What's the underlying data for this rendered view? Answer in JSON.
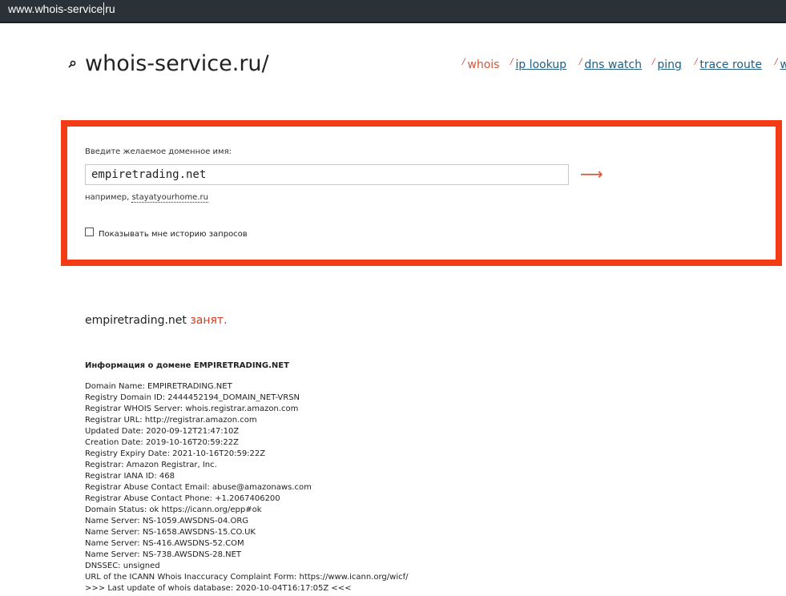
{
  "address_bar": {
    "url_before_caret": "www.whois-service",
    "url_after_caret": "ru"
  },
  "header": {
    "logo_text": "whois-service.ru/",
    "logo_icon": "magnifier-icon",
    "nav": [
      {
        "slash": "/",
        "label": "whois",
        "active": true
      },
      {
        "slash": "/",
        "label": "ip lookup",
        "active": false
      },
      {
        "slash": "/",
        "label": "dns watch",
        "active": false
      },
      {
        "slash": "/",
        "label": "ping",
        "active": false
      },
      {
        "slash": "/",
        "label": "trace route",
        "active": false
      },
      {
        "slash": "/",
        "label": "w",
        "active": false
      }
    ]
  },
  "search": {
    "label": "Введите желаемое доменное имя:",
    "input_value": "empiretrading.net",
    "submit_symbol": "⟶",
    "example_prefix": "например, ",
    "example_link": "stayatyourhome.ru",
    "history_label": "Показывать мне историю запросов",
    "border_color": "#f33b16"
  },
  "result": {
    "domain": "empiretrading.net",
    "status": "занят."
  },
  "info": {
    "heading": "Информация о домене EMPIRETRADING.NET",
    "lines": [
      "Domain Name: EMPIRETRADING.NET",
      "Registry Domain ID: 2444452194_DOMAIN_NET-VRSN",
      "Registrar WHOIS Server: whois.registrar.amazon.com",
      "Registrar URL: http://registrar.amazon.com",
      "Updated Date: 2020-09-12T21:47:10Z",
      "Creation Date: 2019-10-16T20:59:22Z",
      "Registry Expiry Date: 2021-10-16T20:59:22Z",
      "Registrar: Amazon Registrar, Inc.",
      "Registrar IANA ID: 468",
      "Registrar Abuse Contact Email: abuse@amazonaws.com",
      "Registrar Abuse Contact Phone: +1.2067406200",
      "Domain Status: ok https://icann.org/epp#ok",
      "Name Server: NS-1059.AWSDNS-04.ORG",
      "Name Server: NS-1658.AWSDNS-15.CO.UK",
      "Name Server: NS-416.AWSDNS-52.COM",
      "Name Server: NS-738.AWSDNS-28.NET",
      "DNSSEC: unsigned",
      "URL of the ICANN Whois Inaccuracy Complaint Form: https://www.icann.org/wicf/",
      ">>> Last update of whois database: 2020-10-04T16:17:05Z <<<"
    ]
  }
}
